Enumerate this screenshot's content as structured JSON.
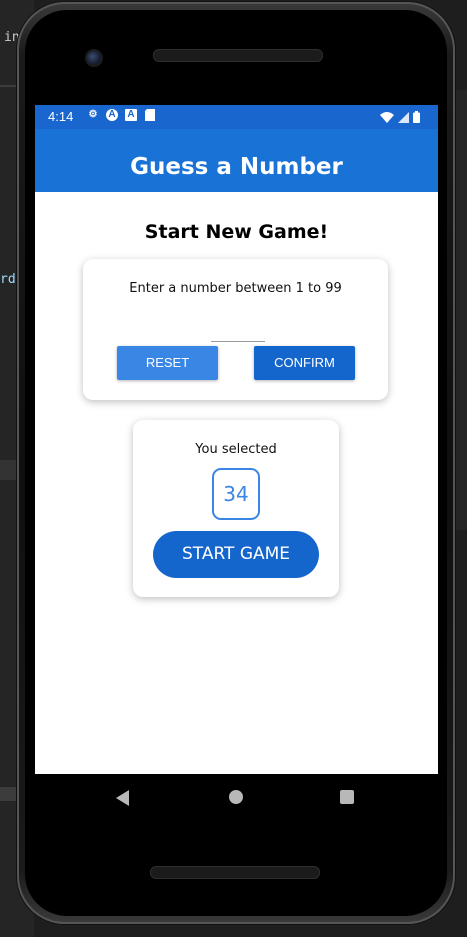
{
  "status": {
    "time": "4:14"
  },
  "app": {
    "title": "Guess a Number"
  },
  "start_screen": {
    "title": "Start New Game!",
    "input_card": {
      "label": "Enter a number between 1 to 99",
      "input_value": "",
      "reset_label": "RESET",
      "confirm_label": "CONFIRM"
    },
    "summary_card": {
      "label": "You selected",
      "selected_number": "34",
      "start_label": "START GAME"
    }
  },
  "editor_fragments": {
    "top_left": "in",
    "mid_left": "rdV"
  },
  "colors": {
    "primary": "#1973d6",
    "status_bar": "#1966cf",
    "accent_light": "#3a86e4",
    "button_dark": "#1566cc"
  },
  "icons": {
    "status_left": [
      "settings-icon",
      "a-icon",
      "a-box-icon",
      "sd-card-icon"
    ],
    "status_right": [
      "wifi-icon",
      "cellular-icon",
      "battery-icon"
    ],
    "nav": [
      "back-icon",
      "home-icon",
      "recents-icon"
    ]
  }
}
